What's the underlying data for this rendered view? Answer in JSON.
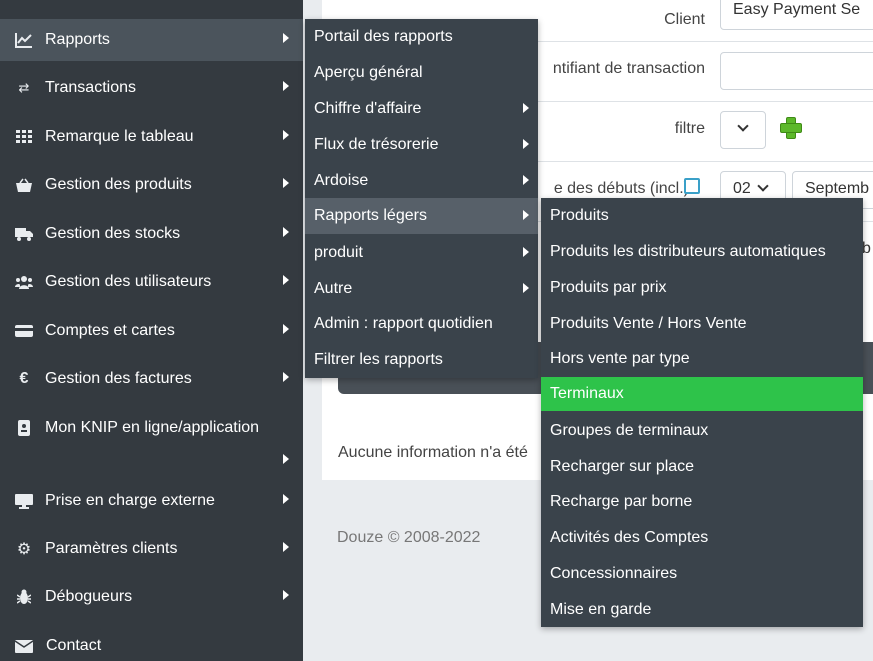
{
  "sidebar": {
    "items": [
      {
        "label": "Rapports",
        "icon": "chart-line-icon",
        "glyph": "📈"
      },
      {
        "label": "Transactions",
        "icon": "exchange-icon",
        "glyph": "⇄"
      },
      {
        "label": "Remarque le tableau",
        "icon": "grid-icon",
        "glyph": "▦"
      },
      {
        "label": "Gestion des produits",
        "icon": "basket-icon",
        "glyph": "🧺"
      },
      {
        "label": "Gestion des stocks",
        "icon": "truck-icon",
        "glyph": "🚚"
      },
      {
        "label": "Gestion des utilisateurs",
        "icon": "users-icon",
        "glyph": "👥"
      },
      {
        "label": "Comptes et cartes",
        "icon": "credit-card-icon",
        "glyph": "▬"
      },
      {
        "label": "Gestion des factures",
        "icon": "euro-icon",
        "glyph": "€"
      },
      {
        "label": "Mon KNIP en ligne/application",
        "icon": "mobile-id-icon",
        "glyph": "▯"
      },
      {
        "label": "Prise en charge externe",
        "icon": "monitor-icon",
        "glyph": "▭"
      },
      {
        "label": "Paramètres clients",
        "icon": "gears-icon",
        "glyph": "⚙"
      },
      {
        "label": "Débogueurs",
        "icon": "bug-icon",
        "glyph": "✱"
      },
      {
        "label": "Contact",
        "icon": "envelope-icon",
        "glyph": "✉"
      }
    ]
  },
  "form": {
    "client_label": "Client",
    "client_value": "Easy Payment Se",
    "transaction_label": "ntifiant de transaction",
    "transaction_value": "",
    "filter_label": "filtre",
    "date_label": "e des débuts (incl.)",
    "day_value": "02",
    "month_value": "Septemb",
    "extra_value": "b"
  },
  "main": {
    "no_info": "Aucune information n'a été",
    "footer": "Douze © 2008-2022"
  },
  "submenu": {
    "items": [
      {
        "label": "Portail des rapports",
        "has_arrow": false
      },
      {
        "label": "Aperçu général",
        "has_arrow": false
      },
      {
        "label": "Chiffre d'affaire",
        "has_arrow": true
      },
      {
        "label": "Flux de trésorerie",
        "has_arrow": true
      },
      {
        "label": "Ardoise",
        "has_arrow": true
      },
      {
        "label": "Rapports légers",
        "has_arrow": true
      },
      {
        "label": "produit",
        "has_arrow": true
      },
      {
        "label": "Autre",
        "has_arrow": true
      },
      {
        "label": "Admin : rapport quotidien",
        "has_arrow": false
      },
      {
        "label": "Filtrer les rapports",
        "has_arrow": false
      }
    ]
  },
  "submenu3": {
    "items": [
      "Produits",
      "Produits les distributeurs automatiques",
      "Produits par prix",
      "Produits Vente / Hors Vente",
      "Hors vente par type",
      "Terminaux",
      "Groupes de terminaux",
      "Recharger sur place",
      "Recharge par borne",
      "Activités des Comptes",
      "Concessionnaires",
      "Mise en garde"
    ]
  },
  "colors": {
    "sidebar_bg": "#343a40",
    "submenu_bg": "#3a434b",
    "highlight_green": "#2ec34a",
    "active_gray": "#4b545c"
  }
}
